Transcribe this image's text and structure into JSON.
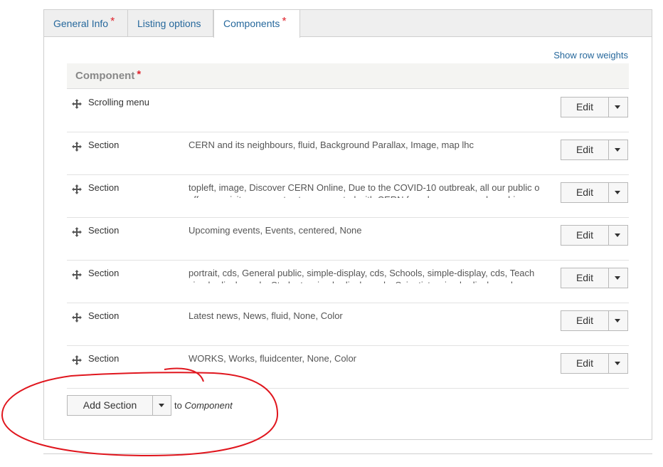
{
  "tabs": [
    {
      "label": "General Info",
      "required": "*"
    },
    {
      "label": "Listing options",
      "required": ""
    },
    {
      "label": "Components",
      "required": "*"
    }
  ],
  "show_row_weights": "Show row weights",
  "table": {
    "header": "Component",
    "header_required": "*",
    "rows": [
      {
        "type": "Scrolling menu",
        "summary": "",
        "summary2": "",
        "edit": "Edit"
      },
      {
        "type": "Section",
        "summary": "CERN and its neighbours, fluid, Background Parallax, Image, map lhc",
        "summary2": "",
        "edit": "Edit"
      },
      {
        "type": "Section",
        "summary": "topleft, image, Discover CERN Online, Due to the COVID-10 outbreak, all our public o",
        "summary2": "offer our visitors a way to stay connected with CERN from home, we are launching",
        "edit": "Edit"
      },
      {
        "type": "Section",
        "summary": "Upcoming events, Events, centered, None",
        "summary2": "",
        "edit": "Edit"
      },
      {
        "type": "Section",
        "summary": "portrait, cds, General public, simple-display, cds, Schools, simple-display, cds, Teach",
        "summary2": "simple-display, cds, Students, simple-display, cds, Scientists, simple-display, cds",
        "edit": "Edit"
      },
      {
        "type": "Section",
        "summary": "Latest news, News, fluid, None, Color",
        "summary2": "",
        "edit": "Edit"
      },
      {
        "type": "Section",
        "summary": "WORKS, Works, fluidcenter, None, Color",
        "summary2": "",
        "edit": "Edit"
      }
    ]
  },
  "add_section": {
    "button": "Add Section",
    "to_prefix": "to",
    "to_target": "Component"
  },
  "colors": {
    "link": "#26689c",
    "required": "#e0242e",
    "annotation": "#e0161e"
  },
  "icons": {
    "drag": "drag-handle-icon",
    "caret": "chevron-down-icon"
  }
}
